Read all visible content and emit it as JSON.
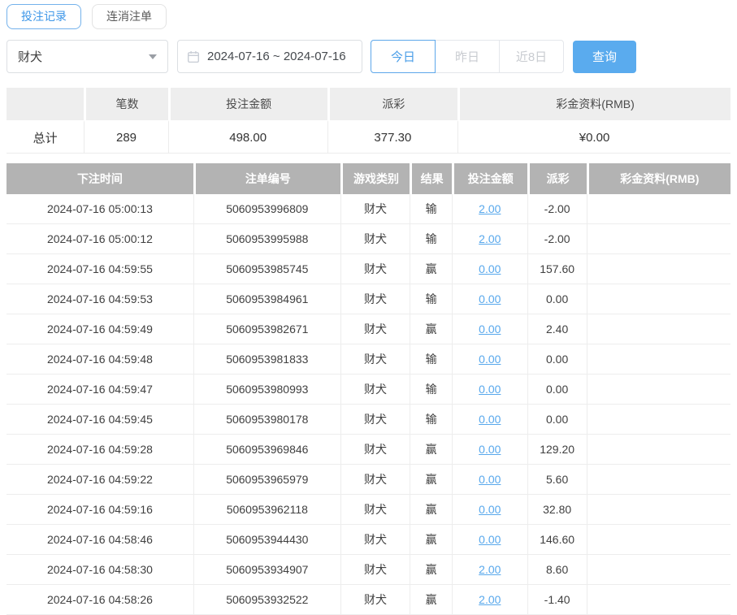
{
  "tabs": [
    {
      "label": "投注记录",
      "active": true
    },
    {
      "label": "连消注单",
      "active": false
    }
  ],
  "filters": {
    "game_select": {
      "value": "财犬"
    },
    "date_range": {
      "value": "2024-07-16 ~ 2024-07-16"
    },
    "quick_buttons": [
      {
        "label": "今日",
        "active": true
      },
      {
        "label": "昨日",
        "active": false
      },
      {
        "label": "近8日",
        "active": false
      }
    ],
    "search_label": "查询"
  },
  "summary": {
    "headers": [
      "",
      "笔数",
      "投注金额",
      "派彩",
      "彩金资料(RMB)"
    ],
    "row": {
      "label": "总计",
      "count": "289",
      "bet_amount": "498.00",
      "payout": "377.30",
      "bonus": "¥0.00"
    }
  },
  "table": {
    "headers": [
      "下注时间",
      "注单编号",
      "游戏类别",
      "结果",
      "投注金额",
      "派彩",
      "彩金资料(RMB)"
    ],
    "rows": [
      {
        "time": "2024-07-16 05:00:13",
        "order_no": "5060953996809",
        "game": "财犬",
        "result": "输",
        "bet": "2.00",
        "payout": "-2.00",
        "bonus": ""
      },
      {
        "time": "2024-07-16 05:00:12",
        "order_no": "5060953995988",
        "game": "财犬",
        "result": "输",
        "bet": "2.00",
        "payout": "-2.00",
        "bonus": ""
      },
      {
        "time": "2024-07-16 04:59:55",
        "order_no": "5060953985745",
        "game": "财犬",
        "result": "赢",
        "bet": "0.00",
        "payout": "157.60",
        "bonus": ""
      },
      {
        "time": "2024-07-16 04:59:53",
        "order_no": "5060953984961",
        "game": "财犬",
        "result": "输",
        "bet": "0.00",
        "payout": "0.00",
        "bonus": ""
      },
      {
        "time": "2024-07-16 04:59:49",
        "order_no": "5060953982671",
        "game": "财犬",
        "result": "赢",
        "bet": "0.00",
        "payout": "2.40",
        "bonus": ""
      },
      {
        "time": "2024-07-16 04:59:48",
        "order_no": "5060953981833",
        "game": "财犬",
        "result": "输",
        "bet": "0.00",
        "payout": "0.00",
        "bonus": ""
      },
      {
        "time": "2024-07-16 04:59:47",
        "order_no": "5060953980993",
        "game": "财犬",
        "result": "输",
        "bet": "0.00",
        "payout": "0.00",
        "bonus": ""
      },
      {
        "time": "2024-07-16 04:59:45",
        "order_no": "5060953980178",
        "game": "财犬",
        "result": "输",
        "bet": "0.00",
        "payout": "0.00",
        "bonus": ""
      },
      {
        "time": "2024-07-16 04:59:28",
        "order_no": "5060953969846",
        "game": "财犬",
        "result": "赢",
        "bet": "0.00",
        "payout": "129.20",
        "bonus": ""
      },
      {
        "time": "2024-07-16 04:59:22",
        "order_no": "5060953965979",
        "game": "财犬",
        "result": "赢",
        "bet": "0.00",
        "payout": "5.60",
        "bonus": ""
      },
      {
        "time": "2024-07-16 04:59:16",
        "order_no": "5060953962118",
        "game": "财犬",
        "result": "赢",
        "bet": "0.00",
        "payout": "32.80",
        "bonus": ""
      },
      {
        "time": "2024-07-16 04:58:46",
        "order_no": "5060953944430",
        "game": "财犬",
        "result": "赢",
        "bet": "0.00",
        "payout": "146.60",
        "bonus": ""
      },
      {
        "time": "2024-07-16 04:58:30",
        "order_no": "5060953934907",
        "game": "财犬",
        "result": "赢",
        "bet": "2.00",
        "payout": "8.60",
        "bonus": ""
      },
      {
        "time": "2024-07-16 04:58:26",
        "order_no": "5060953932522",
        "game": "财犬",
        "result": "赢",
        "bet": "2.00",
        "payout": "-1.40",
        "bonus": ""
      }
    ]
  },
  "icons": {
    "calendar": "calendar-icon",
    "caret": "caret-down-icon"
  },
  "colors": {
    "accent_blue": "#5aabee",
    "active_border_blue": "#5da7ea",
    "link_blue": "#58a8ec",
    "negative_red": "#e2707a",
    "table_header_gray": "#b3b3b3",
    "summary_header_gray": "#eeeeee"
  }
}
